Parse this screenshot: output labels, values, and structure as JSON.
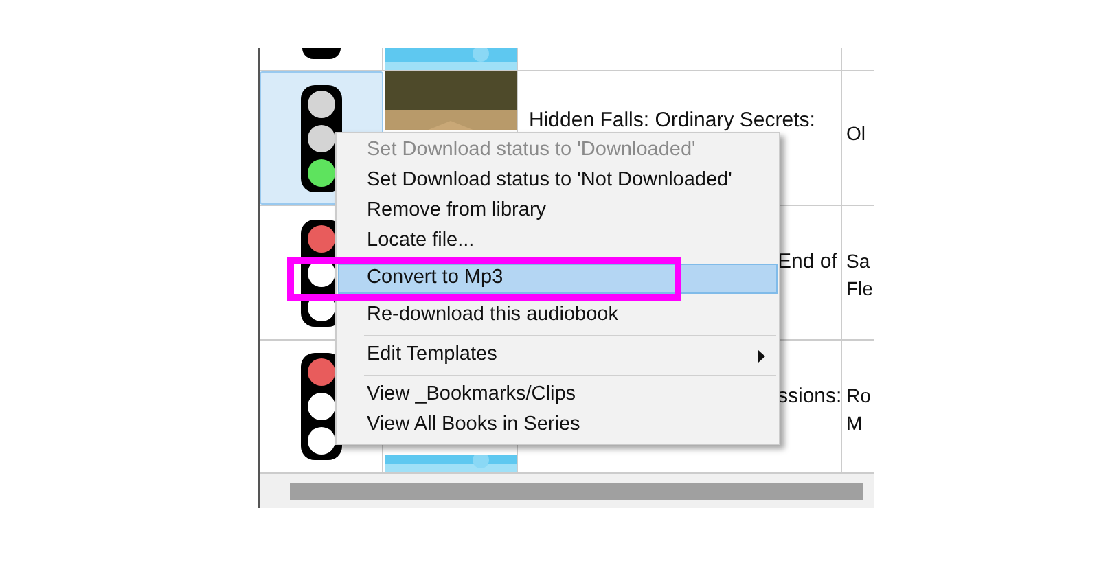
{
  "table": {
    "rows": [
      {
        "selected": false,
        "cover": {
          "kind": "picture"
        },
        "title": "",
        "author": []
      },
      {
        "selected": true,
        "downloaded": true,
        "cover": {
          "kind": "picture"
        },
        "title": "Hidden Falls: Ordinary Secrets:",
        "author": [
          "Ol"
        ]
      },
      {
        "selected": false,
        "downloaded": false,
        "title": "End of",
        "author": [
          "Sa",
          "Fle"
        ]
      },
      {
        "selected": false,
        "downloaded": false,
        "cover": {
          "kind": "picture"
        },
        "title": "ssions:",
        "author": [
          "Ro",
          "M"
        ]
      }
    ]
  },
  "context_menu": {
    "items": [
      {
        "kind": "item",
        "label": "Set Download status to 'Downloaded'",
        "disabled": true,
        "selected": false
      },
      {
        "kind": "item",
        "label": "Set Download status to 'Not Downloaded'",
        "disabled": false,
        "selected": false
      },
      {
        "kind": "item",
        "label": "Remove from library",
        "disabled": false,
        "selected": false
      },
      {
        "kind": "item",
        "label": "Locate file...",
        "disabled": false,
        "selected": false
      },
      {
        "kind": "item",
        "label": "Convert to Mp3",
        "disabled": false,
        "selected": true
      },
      {
        "kind": "item",
        "label": "Re-download this audiobook",
        "disabled": false,
        "selected": false
      },
      {
        "kind": "separator"
      },
      {
        "kind": "submenu",
        "label": "Edit Templates",
        "disabled": false,
        "selected": false
      },
      {
        "kind": "separator"
      },
      {
        "kind": "item",
        "label": "View _Bookmarks/Clips",
        "disabled": false,
        "selected": false
      },
      {
        "kind": "item",
        "label": "View All Books in Series",
        "disabled": false,
        "selected": false
      }
    ]
  }
}
